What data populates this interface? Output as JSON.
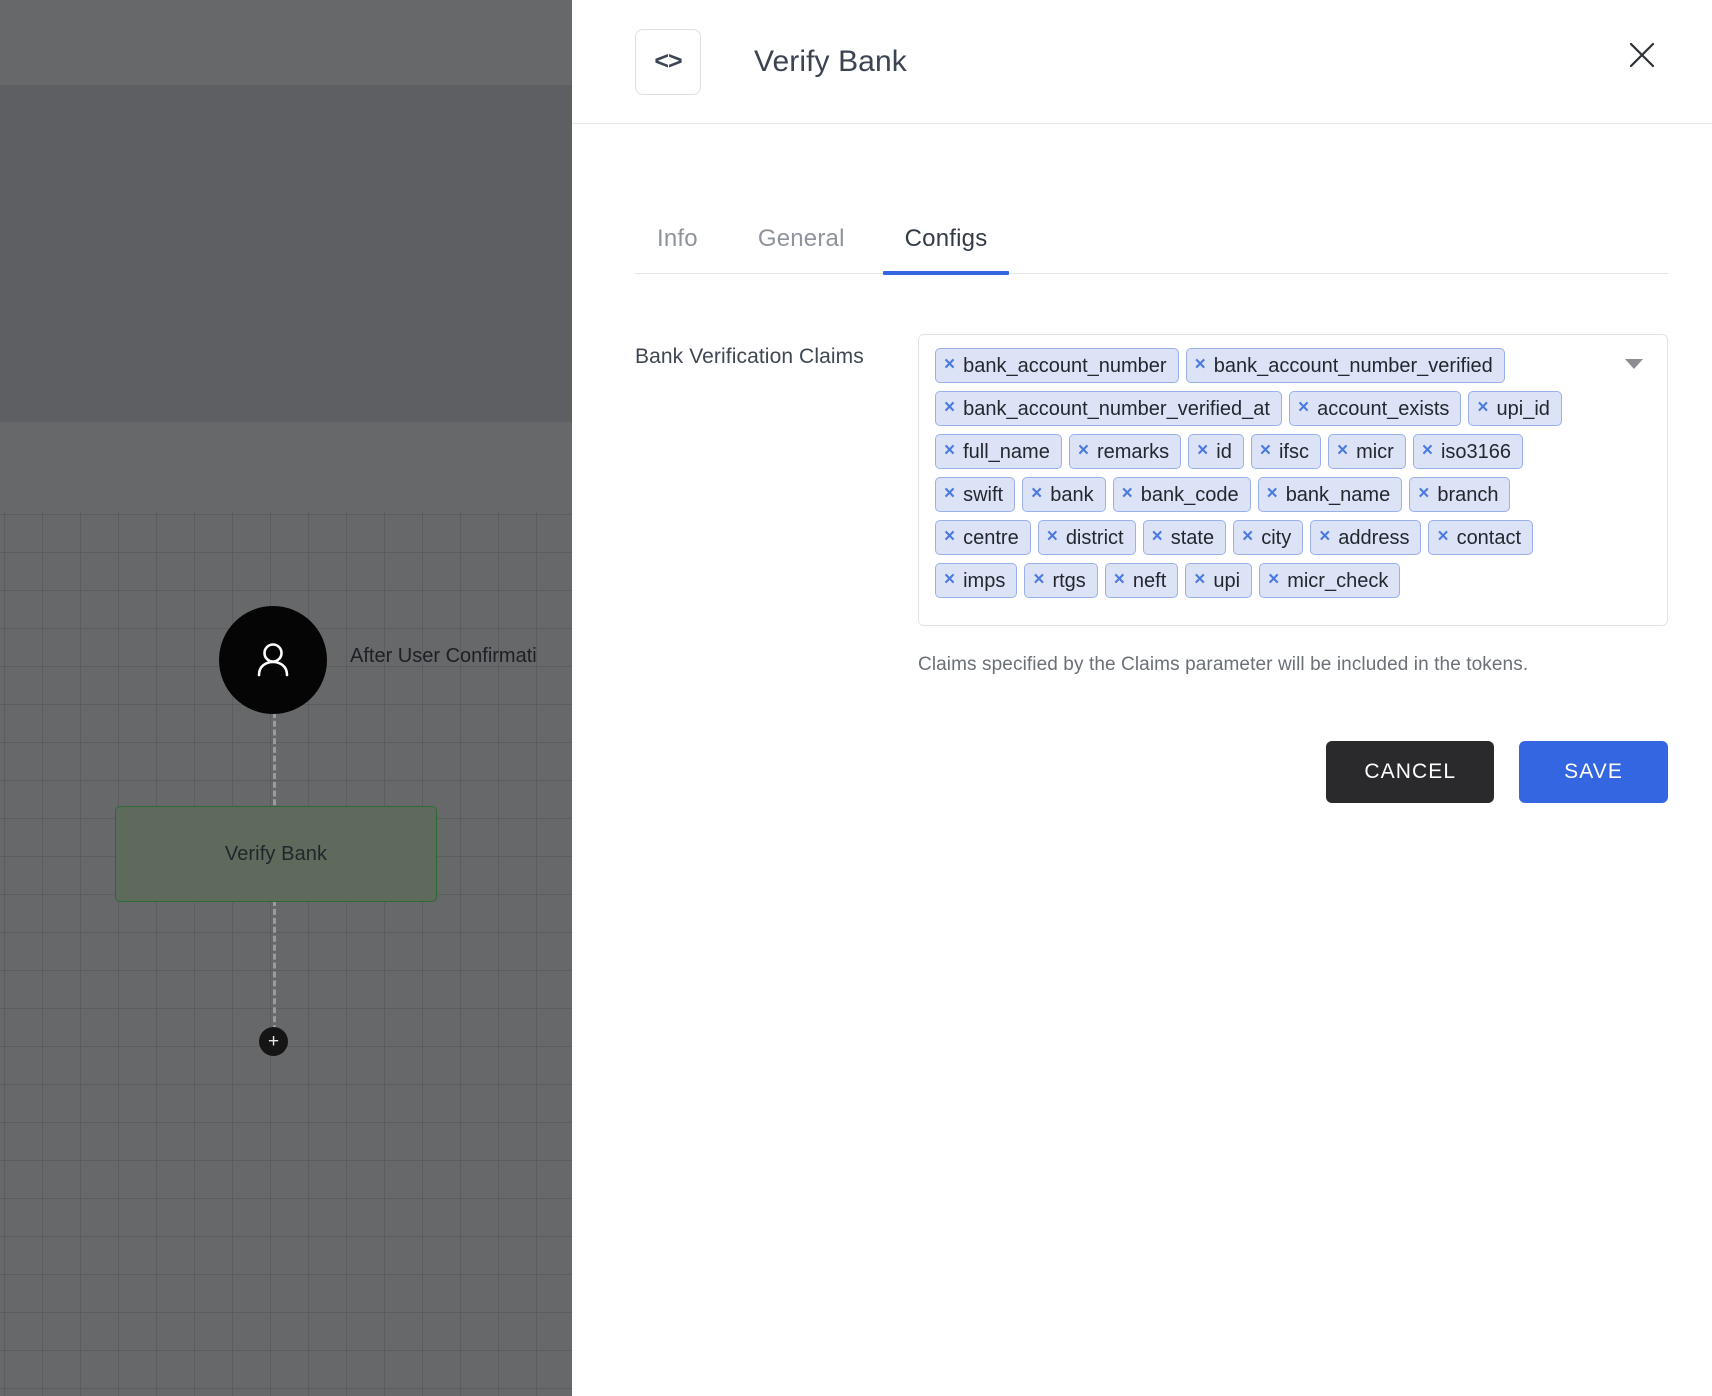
{
  "canvas": {
    "edge_label": "After User Confirmati",
    "avatar_icon": "person-icon",
    "node_label": "Verify Bank",
    "add_node_glyph": "+"
  },
  "panel": {
    "icon": "code-brackets-icon",
    "icon_glyph": "<>",
    "title": "Verify Bank",
    "close_icon": "close-icon"
  },
  "tabs": [
    {
      "label": "Info",
      "active": false
    },
    {
      "label": "General",
      "active": false
    },
    {
      "label": "Configs",
      "active": true
    }
  ],
  "field": {
    "label": "Bank Verification Claims",
    "dropdown_icon": "chevron-down-icon",
    "helper_text": "Claims specified by the Claims parameter will be included in the tokens.",
    "chips": [
      "bank_account_number",
      "bank_account_number_verified",
      "bank_account_number_verified_at",
      "account_exists",
      "upi_id",
      "full_name",
      "remarks",
      "id",
      "ifsc",
      "micr",
      "iso3166",
      "swift",
      "bank",
      "bank_code",
      "bank_name",
      "branch",
      "centre",
      "district",
      "state",
      "city",
      "address",
      "contact",
      "imps",
      "rtgs",
      "neft",
      "upi",
      "micr_check"
    ],
    "chip_remove_glyph": "×"
  },
  "actions": {
    "cancel_label": "CANCEL",
    "save_label": "SAVE"
  },
  "colors": {
    "accent": "#3366e0",
    "chip_bg": "#dde3f7",
    "chip_border": "#9ab0ea",
    "chip_x": "#4a7ae0",
    "cancel_bg": "#2a2a2d",
    "node_fill": "#5e6b5c",
    "node_border": "#2b6b32"
  }
}
